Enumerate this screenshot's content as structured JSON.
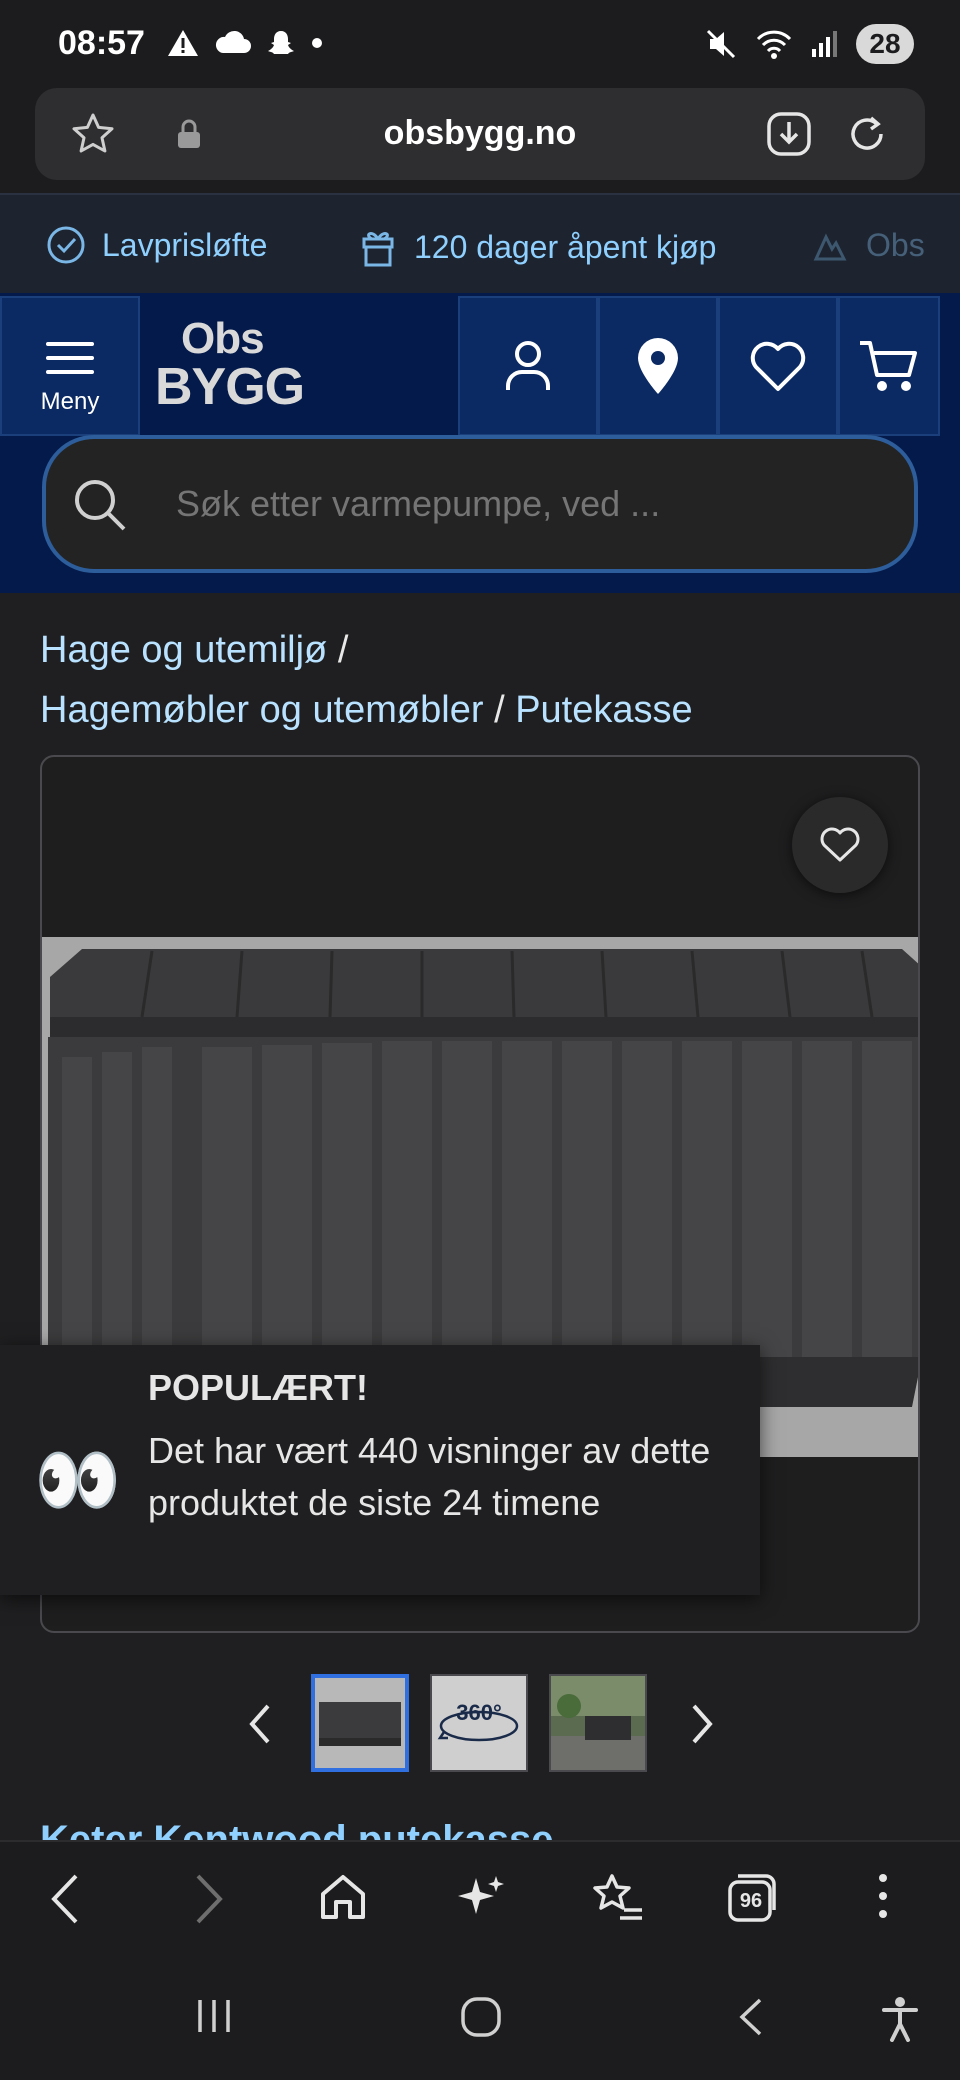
{
  "status_bar": {
    "time": "08:57",
    "battery": "28",
    "wifi_label": "5"
  },
  "browser": {
    "url": "obsbygg.no",
    "tabs_count": "96"
  },
  "promo": {
    "items": [
      {
        "label": "Lavprisløfte"
      },
      {
        "label": "120 dager åpent kjøp"
      },
      {
        "label": "Obs"
      }
    ]
  },
  "header": {
    "menu_label": "Meny",
    "logo_top": "Obs",
    "logo_bottom": "BYGG"
  },
  "search": {
    "placeholder": "Søk etter varmepumpe, ved ..."
  },
  "breadcrumb": {
    "items": [
      "Hage og utemiljø",
      "Hagemøbler og utemøbler",
      "Putekasse"
    ],
    "separator": "/"
  },
  "popular": {
    "title": "POPULÆRT!",
    "text": "Det har vært 440 visninger av dette produktet de siste 24 timene",
    "emoji": "👀"
  },
  "thumbnails": {
    "label_360": "360°"
  },
  "product": {
    "title": "Keter Kentwood putekasse"
  },
  "colors": {
    "accent_link": "#8fd0ff",
    "header_bg": "#041a4a",
    "active_thumb": "#2f6fe0"
  }
}
